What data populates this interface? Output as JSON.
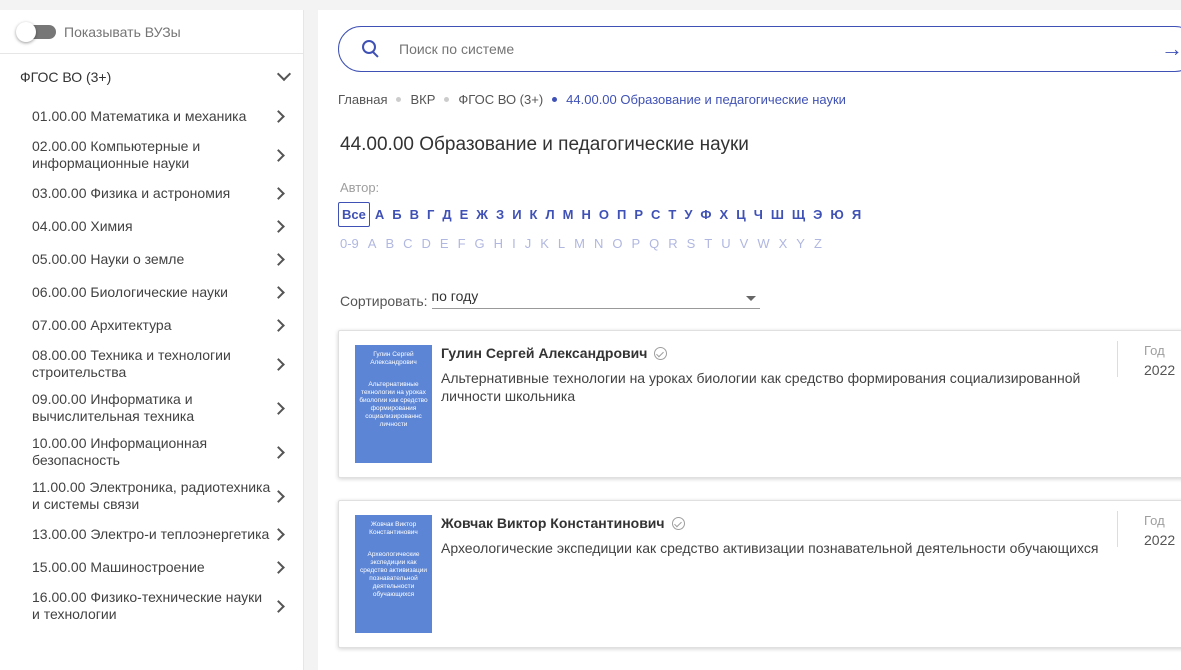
{
  "sidebar": {
    "toggle_label": "Показывать ВУЗы",
    "section_label": "ФГОС ВО (3+)",
    "items": [
      {
        "label": "01.00.00 Математика и механика"
      },
      {
        "label": "02.00.00 Компьютерные и информационные науки"
      },
      {
        "label": "03.00.00 Физика и астрономия"
      },
      {
        "label": "04.00.00 Химия"
      },
      {
        "label": "05.00.00 Науки о земле"
      },
      {
        "label": "06.00.00 Биологические науки"
      },
      {
        "label": "07.00.00 Архитектура"
      },
      {
        "label": "08.00.00 Техника и технологии строительства"
      },
      {
        "label": "09.00.00 Информатика и вычислительная техника"
      },
      {
        "label": "10.00.00 Информационная безопасность"
      },
      {
        "label": "11.00.00 Электроника, радиотехника и системы связи"
      },
      {
        "label": "13.00.00 Электро-и теплоэнергетика"
      },
      {
        "label": "15.00.00 Машиностроение"
      },
      {
        "label": "16.00.00 Физико-технические науки и технологии"
      }
    ]
  },
  "search": {
    "placeholder": "Поиск по системе",
    "go_icon": "→"
  },
  "breadcrumb": {
    "items": [
      "Главная",
      "ВКР",
      "ФГОС ВО (3+)"
    ],
    "current": "44.00.00 Образование и педагогические науки"
  },
  "page_title": "44.00.00 Образование и педагогические науки",
  "author_filter": {
    "label": "Автор:",
    "all_label": "Все",
    "ru_letters": [
      "А",
      "Б",
      "В",
      "Г",
      "Д",
      "Е",
      "Ж",
      "З",
      "И",
      "К",
      "Л",
      "М",
      "Н",
      "О",
      "П",
      "Р",
      "С",
      "Т",
      "У",
      "Ф",
      "Х",
      "Ц",
      "Ч",
      "Ш",
      "Щ",
      "Э",
      "Ю",
      "Я"
    ],
    "en_letters": [
      "0-9",
      "A",
      "B",
      "C",
      "D",
      "E",
      "F",
      "G",
      "H",
      "I",
      "J",
      "K",
      "L",
      "M",
      "N",
      "O",
      "P",
      "Q",
      "R",
      "S",
      "T",
      "U",
      "V",
      "W",
      "X",
      "Y",
      "Z"
    ]
  },
  "sort": {
    "label": "Сортировать:",
    "value": "по году"
  },
  "works": [
    {
      "author": "Гулин Сергей Александрович",
      "title": "Альтернативные технологии на уроках биологии как средство формирования социализированной личности школьника",
      "cover_author": "Гулин Сергей Александрович",
      "cover_title": "Альтернативные технологии на уроках биологии как средство формирования социализированнс личности",
      "year_label": "Год",
      "year": "2022"
    },
    {
      "author": "Жовчак Виктор Константинович",
      "title": "Археологические экспедиции как средство активизации познавательной деятельности обучающихся",
      "cover_author": "Жовчак Виктор Константинович",
      "cover_title": "Археологические экспедиции как средство активизации познавательной деятельности обучающихся",
      "year_label": "Год",
      "year": "2022"
    }
  ],
  "colors": {
    "accent": "#3f51b5",
    "cover": "#5c85d6"
  }
}
